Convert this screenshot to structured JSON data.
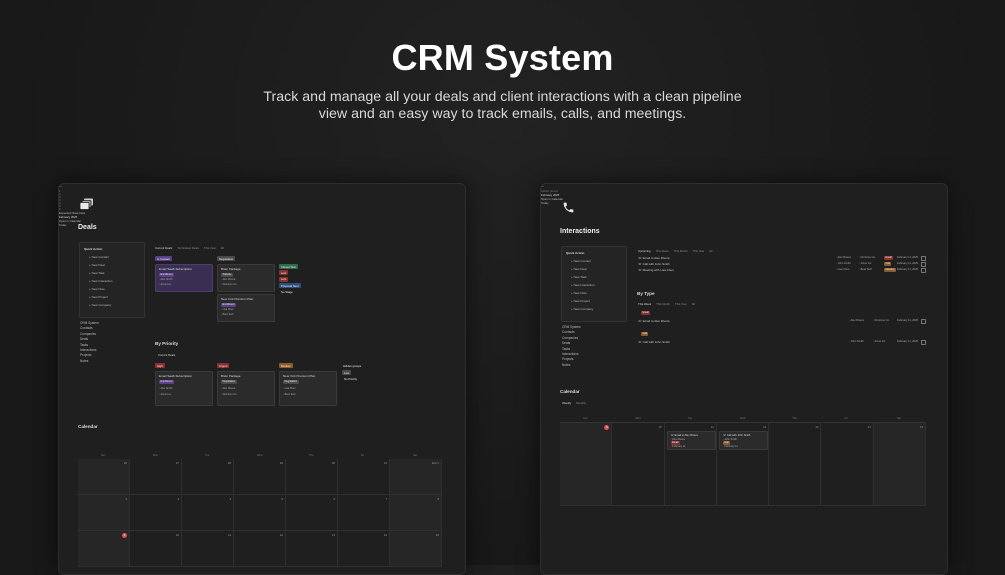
{
  "hero": {
    "title": "CRM System",
    "subtitle": "Track and manage all your deals and client interactions with a clean pipeline view and an easy way to track emails, calls, and meetings."
  },
  "colors": {
    "bg": "#1b1b1b",
    "panel": "#1f1f1f",
    "purple": "#5b3f86",
    "green": "#2f6b4a",
    "yellow": "#7a6a2a",
    "orange": "#8a5a2a",
    "red": "#8a3030",
    "blue": "#2f4f7a",
    "gray": "#4a4a4a"
  },
  "deals": {
    "icon": "stack-icon",
    "title": "Deals",
    "quick_action_label": "Quick Action",
    "quick_actions": [
      "New Contact",
      "New Deal",
      "New Task",
      "New Interaction",
      "New Note",
      "New Project",
      "New Company"
    ],
    "nav": [
      "CRM System",
      "Contacts",
      "Companies",
      "Deals",
      "Tasks",
      "Interactions",
      "Projects",
      "Notes"
    ],
    "tabs": [
      "Current Deals",
      "Terminated Deals",
      "This Year",
      "All"
    ],
    "pipeline": [
      {
        "stage": "In Contact",
        "count": "1",
        "cards": [
          {
            "title": "Email SaaS Subscription",
            "tag": "Enrollment",
            "people": [
              "Alex Smith",
              "Acme Inc."
            ]
          }
        ]
      },
      {
        "stage": "Negotiation",
        "count": "2",
        "cards": [
          {
            "title": "Brain Package",
            "tag": "Website",
            "people": [
              "Alex Rivera",
              "Dominus Co."
            ]
          },
          {
            "title": "New York Premium Plan",
            "tag": "Enrollment",
            "people": [
              "Lisa Chen",
              "Beta Tech"
            ]
          }
        ]
      },
      {
        "stage": "Closed Won",
        "count": "0",
        "cards": []
      },
      {
        "stage": "Lost",
        "count": "0",
        "cards": []
      },
      {
        "stage": "Lost",
        "count": "0",
        "cards": []
      },
      {
        "stage": "Proposal Sent",
        "count": "0",
        "cards": []
      },
      {
        "stage": "No Stage",
        "count": "0",
        "cards": []
      }
    ],
    "by_priority_label": "By Priority",
    "by_priority_tab": "Current Deals",
    "priority_cols": [
      {
        "level": "High",
        "cards": [
          {
            "title": "Email SaaS Subscription",
            "tag": "Enrollment",
            "people": [
              "Alex Smith",
              "Acme Inc."
            ]
          }
        ]
      },
      {
        "level": "Urgent",
        "cards": [
          {
            "title": "Brain Package",
            "tag": "Negotiation",
            "people": [
              "Alex Rivera",
              "Dominus Co."
            ]
          }
        ]
      },
      {
        "level": "Medium",
        "cards": [
          {
            "title": "New York Premium Plan",
            "tag": "Negotiation",
            "people": [
              "Lisa Chen",
              "Beta Tech"
            ]
          }
        ]
      },
      {
        "level": "Hidden groups",
        "cards": []
      }
    ],
    "hidden_items": [
      "Low",
      "No Priority"
    ],
    "calendar_label": "Calendar",
    "calendar_view": "Expected Close Date",
    "month": "February 2025",
    "open_in_calendar": "Open in Calendar",
    "today_label": "Today",
    "weekdays": [
      "Sun",
      "Mon",
      "Tue",
      "Wed",
      "Thu",
      "Fri",
      "Sat"
    ],
    "day_rows": [
      [
        "26",
        "27",
        "28",
        "29",
        "30",
        "31",
        "Feb 1"
      ],
      [
        "2",
        "3",
        "4",
        "5",
        "6",
        "7",
        "8"
      ],
      [
        "9",
        "10",
        "11",
        "12",
        "13",
        "14",
        "15"
      ]
    ]
  },
  "interactions": {
    "icon": "phone-icon",
    "title": "Interactions",
    "quick_action_label": "Quick Action",
    "quick_actions": [
      "New Contact",
      "New Deal",
      "New Task",
      "New Interaction",
      "New Note",
      "New Project",
      "New Company"
    ],
    "nav": [
      "CRM System",
      "Contacts",
      "Companies",
      "Deals",
      "Tasks",
      "Interactions",
      "Projects",
      "Notes"
    ],
    "tabs": [
      "Upcoming",
      "This Week",
      "This Month",
      "This Year",
      "All"
    ],
    "upcoming": [
      {
        "title": "Email to Alex Rivera",
        "who": "Alex Rivera",
        "company": "Dominus Co.",
        "type": "Email",
        "date": "February 11, 2025"
      },
      {
        "title": "Call with John Smith",
        "who": "John Smith",
        "company": "Acme Inc.",
        "type": "Call",
        "date": "February 11, 2025"
      },
      {
        "title": "Meeting with Lisa Chen",
        "who": "Lisa Chen",
        "company": "Beta Tech",
        "type": "Meeting",
        "date": "February 11, 2025"
      }
    ],
    "by_type_label": "By Type",
    "by_type_tabs": [
      "This Week",
      "This Month",
      "This Year",
      "All"
    ],
    "groups": [
      {
        "type": "Email",
        "rows": [
          {
            "title": "Email to Alex Rivera",
            "who": "Alex Rivera",
            "company": "Dominus Co.",
            "date": "February 11, 2025"
          }
        ]
      },
      {
        "type": "Call",
        "rows": [
          {
            "title": "Call with John Smith",
            "who": "John Smith",
            "company": "Acme Inc.",
            "date": "February 11, 2025"
          }
        ]
      }
    ],
    "hidden_groups": "Hidden groups",
    "calendar_label": "Calendar",
    "cal_tabs": [
      "Weekly",
      "Monthly"
    ],
    "month": "February 2025",
    "open_in_calendar": "Open in Calendar",
    "today_label": "Today",
    "weekdays": [
      "Sun",
      "Mon",
      "Tue",
      "Wed",
      "Thu",
      "Fri",
      "Sat"
    ],
    "days": [
      "9",
      "10",
      "11",
      "12",
      "13",
      "14",
      "15"
    ],
    "events": [
      {
        "title": "Email to Alex Rivera",
        "who": "Alex Rivera",
        "tag": "Email",
        "date": "February 11"
      },
      {
        "title": "Call with John Smith",
        "who": "John Smith",
        "tag": "Call",
        "date": "February 11"
      }
    ]
  }
}
